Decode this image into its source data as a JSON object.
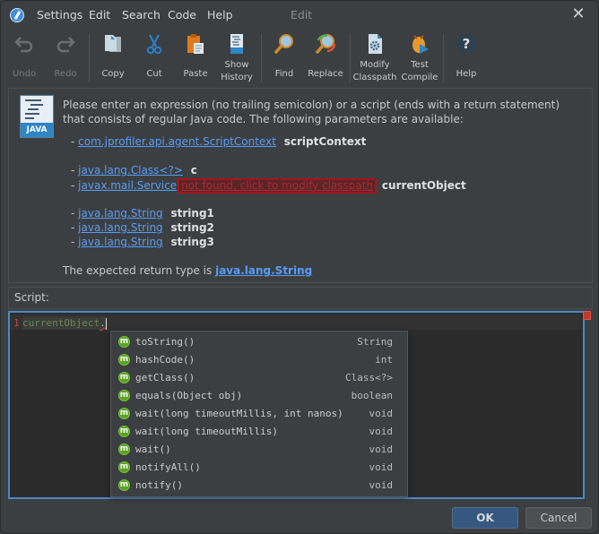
{
  "window": {
    "title": "Edit"
  },
  "menu": [
    "Settings",
    "Edit",
    "Search",
    "Code",
    "Help"
  ],
  "toolbar": {
    "undo": "Undo",
    "redo": "Redo",
    "copy": "Copy",
    "cut": "Cut",
    "paste": "Paste",
    "show_history": [
      "Show",
      "History"
    ],
    "find": "Find",
    "replace": "Replace",
    "modify_classpath": [
      "Modify",
      "Classpath"
    ],
    "test_compile": [
      "Test",
      "Compile"
    ],
    "help": "Help"
  },
  "info": {
    "java_badge": "JAVA",
    "description": "Please enter an expression (no trailing semicolon) or a script (ends with a return statement) that consists of regular Java code. The following parameters are available:",
    "params": [
      {
        "type": "com.jprofiler.api.agent.ScriptContext",
        "name": "scriptContext"
      },
      {
        "type": "java.lang.Class<?>",
        "name": "c"
      },
      {
        "type": "javax.mail.Service",
        "warning": "not found, click to modify classpath",
        "name": "currentObject"
      },
      {
        "type": "java.lang.String",
        "name": "string1"
      },
      {
        "type": "java.lang.String",
        "name": "string2"
      },
      {
        "type": "java.lang.String",
        "name": "string3"
      }
    ],
    "dash": "-",
    "return_prefix": "The expected return type is",
    "return_type": "java.lang.String"
  },
  "script": {
    "label": "Script:",
    "line_number": "1",
    "code": "currentObject",
    "code_dot": "."
  },
  "completion": [
    {
      "signature": "toString()",
      "return": "String"
    },
    {
      "signature": "hashCode()",
      "return": "int"
    },
    {
      "signature": "getClass()",
      "return": "Class<?>"
    },
    {
      "signature": "equals(Object obj)",
      "return": "boolean"
    },
    {
      "signature": "wait(long timeoutMillis, int nanos)",
      "return": "void"
    },
    {
      "signature": "wait(long timeoutMillis)",
      "return": "void"
    },
    {
      "signature": "wait()",
      "return": "void"
    },
    {
      "signature": "notifyAll()",
      "return": "void"
    },
    {
      "signature": "notify()",
      "return": "void"
    }
  ],
  "completion_icon": "m",
  "buttons": {
    "ok": "OK",
    "cancel": "Cancel"
  },
  "colors": {
    "accent": "#4a88c7",
    "link": "#589df6",
    "error": "#a3151d",
    "ok_button": "#365880"
  }
}
